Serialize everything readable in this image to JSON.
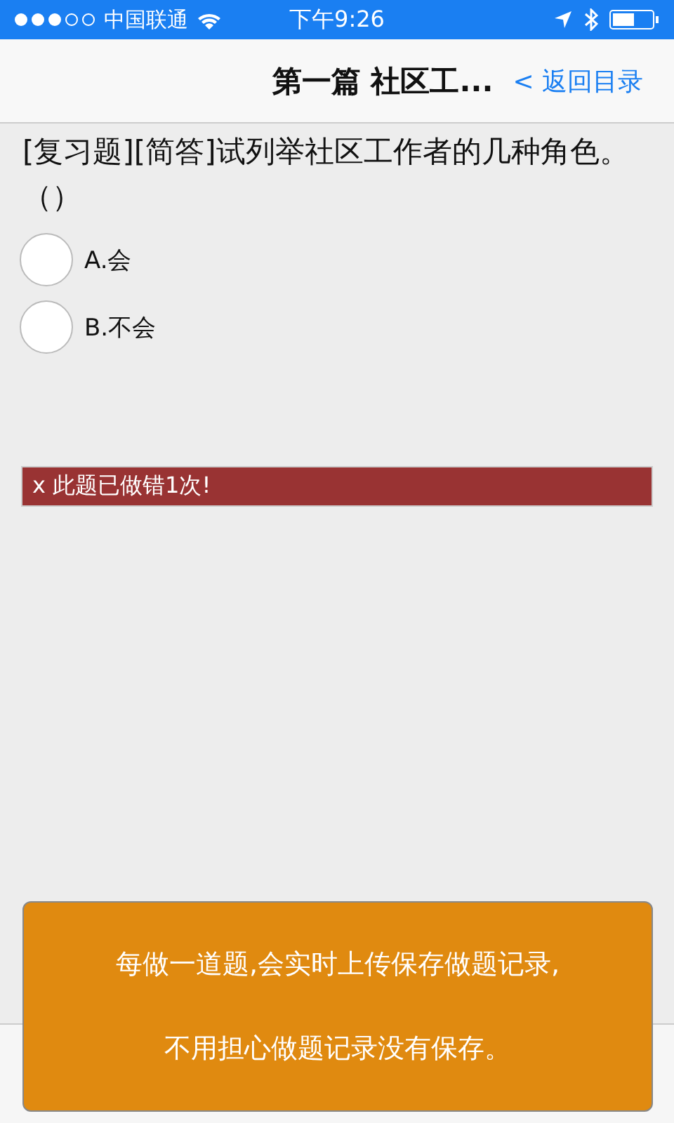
{
  "status_bar": {
    "carrier": "中国联通",
    "time": "下午9:26"
  },
  "nav": {
    "title": "第一篇 社区工...",
    "back": "< 返回目录"
  },
  "question": {
    "text": "[复习题][简答]试列举社区工作者的几种角色。（）",
    "options": [
      {
        "label": "A.会",
        "selected": false
      },
      {
        "label": "B.不会",
        "selected": false
      }
    ]
  },
  "error_banner": "x 此题已做错1次!",
  "toast": {
    "lines": [
      "每做一道题,会实时上传保存做题记录,",
      "不用担心做题记录没有保存。"
    ]
  }
}
